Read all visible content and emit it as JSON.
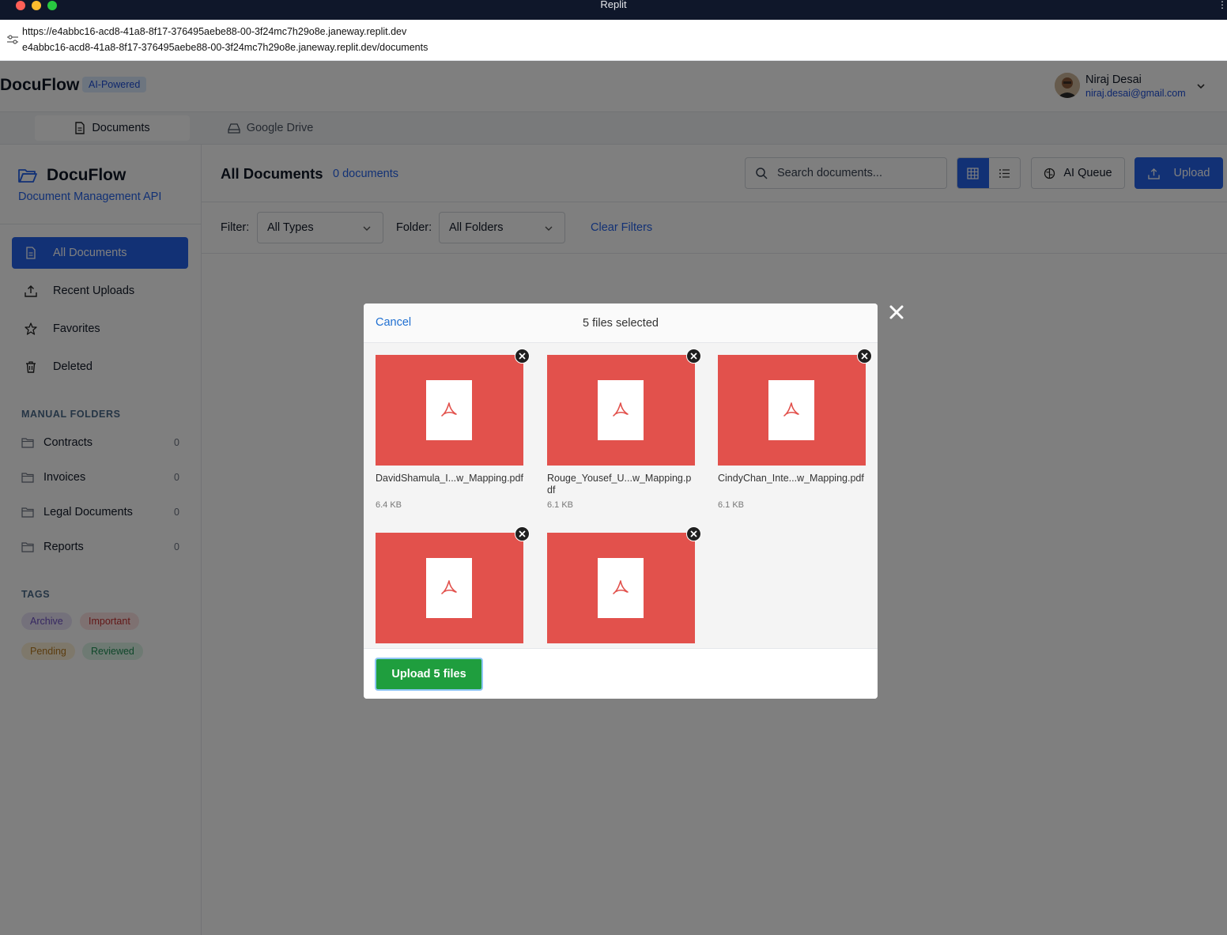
{
  "window": {
    "title": "Replit",
    "menu_glyph": "⋮"
  },
  "urlbar": {
    "url_full": "https://e4abbc16-acd8-41a8-8f17-376495aebe88-00-3f24mc7h29o8e.janeway.replit.dev",
    "url_path": "e4abbc16-acd8-41a8-8f17-376495aebe88-00-3f24mc7h29o8e.janeway.replit.dev/documents"
  },
  "header": {
    "brand": "DocuFlow",
    "badge": "AI-Powered",
    "user": {
      "name": "Niraj Desai",
      "email": "niraj.desai@gmail.com"
    }
  },
  "tabs": [
    {
      "label": "Documents",
      "icon": "document-icon",
      "active": true
    },
    {
      "label": "Google Drive",
      "icon": "drive-icon",
      "active": false
    }
  ],
  "sidebar": {
    "brand": "DocuFlow",
    "subtitle": "Document Management API",
    "nav": [
      {
        "label": "All Documents",
        "icon": "document-icon",
        "active": true
      },
      {
        "label": "Recent Uploads",
        "icon": "upload-icon",
        "active": false
      },
      {
        "label": "Favorites",
        "icon": "star-icon",
        "active": false
      },
      {
        "label": "Deleted",
        "icon": "trash-icon",
        "active": false
      }
    ],
    "folders_title": "MANUAL FOLDERS",
    "folders": [
      {
        "label": "Contracts",
        "count": "0"
      },
      {
        "label": "Invoices",
        "count": "0"
      },
      {
        "label": "Legal Documents",
        "count": "0"
      },
      {
        "label": "Reports",
        "count": "0"
      }
    ],
    "tags_title": "TAGS",
    "tags": [
      {
        "label": "Archive",
        "bg": "#e9e3f7",
        "fg": "#6d4fc2"
      },
      {
        "label": "Important",
        "bg": "#fde2e2",
        "fg": "#c53030"
      },
      {
        "label": "Pending",
        "bg": "#fdf1d6",
        "fg": "#b7791f"
      },
      {
        "label": "Reviewed",
        "bg": "#dcf5e6",
        "fg": "#1f8f55"
      }
    ]
  },
  "main": {
    "title": "All Documents",
    "count": "0 documents",
    "search_placeholder": "Search documents...",
    "ai_queue_label": "AI Queue",
    "upload_label": "Upload",
    "filter_label": "Filter:",
    "filter_value": "All Types",
    "folder_label": "Folder:",
    "folder_value": "All Folders",
    "clear_filters": "Clear Filters"
  },
  "modal": {
    "cancel": "Cancel",
    "title": "5 files selected",
    "files": [
      {
        "name": "DavidShamula_I...w_Mapping.pdf",
        "size": "6.4 KB"
      },
      {
        "name": "Rouge_Yousef_U...w_Mapping.pdf",
        "size": "6.1 KB"
      },
      {
        "name": "CindyChan_Inte...w_Mapping.pdf",
        "size": "6.1 KB"
      },
      {
        "name": "",
        "size": ""
      },
      {
        "name": "",
        "size": ""
      }
    ],
    "upload_button": "Upload 5 files"
  },
  "colors": {
    "accent": "#2563eb",
    "pdf_tile": "#e2514c",
    "upload_green": "#1f9e3e",
    "overlay": "rgba(0,0,0,0.5)"
  }
}
